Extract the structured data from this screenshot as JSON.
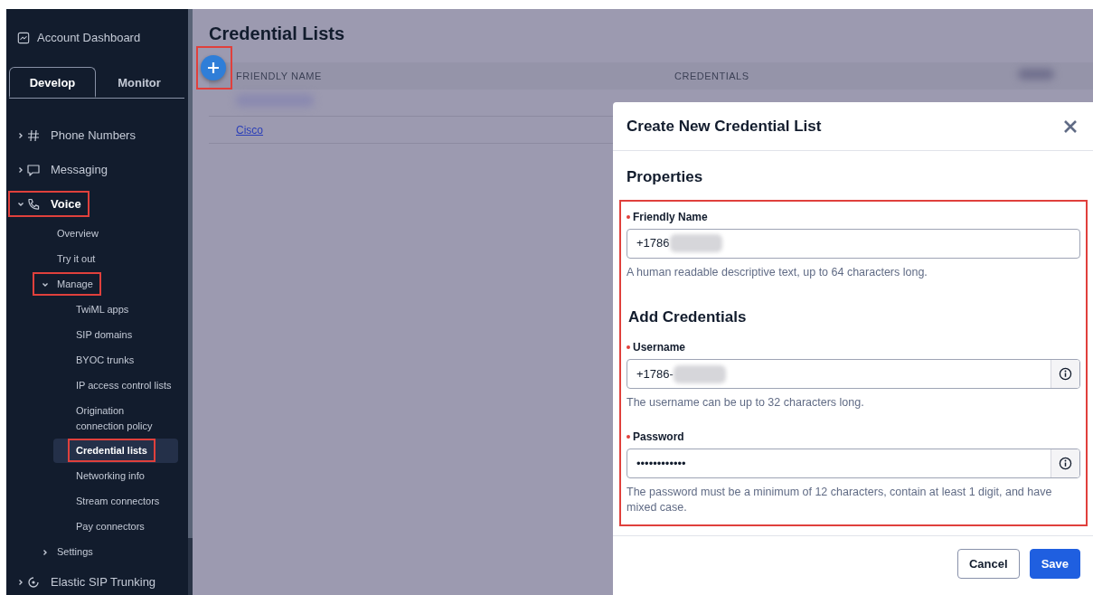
{
  "sidebar": {
    "dashboard_link": "Account Dashboard",
    "tabs": [
      {
        "label": "Develop",
        "selected": true
      },
      {
        "label": "Monitor",
        "selected": false
      }
    ],
    "nav": [
      {
        "label": "Phone Numbers",
        "expanded": false,
        "selected": false,
        "annotated": false
      },
      {
        "label": "Messaging",
        "expanded": false,
        "selected": false,
        "annotated": false
      },
      {
        "label": "Voice",
        "expanded": true,
        "selected": false,
        "annotated": true,
        "children": [
          {
            "label": "Overview",
            "selected": false,
            "annotated": false
          },
          {
            "label": "Try it out",
            "selected": false,
            "annotated": false
          },
          {
            "label": "Manage",
            "expanded": true,
            "selected": false,
            "annotated": true,
            "children": [
              {
                "label": "TwiML apps",
                "selected": false,
                "annotated": false
              },
              {
                "label": "SIP domains",
                "selected": false,
                "annotated": false
              },
              {
                "label": "BYOC trunks",
                "selected": false,
                "annotated": false
              },
              {
                "label": "IP access control lists",
                "selected": false,
                "annotated": false
              },
              {
                "label": "Origination connection policy",
                "selected": false,
                "annotated": false
              },
              {
                "label": "Credential lists",
                "selected": true,
                "annotated": true
              },
              {
                "label": "Networking info",
                "selected": false,
                "annotated": false
              },
              {
                "label": "Stream connectors",
                "selected": false,
                "annotated": false
              },
              {
                "label": "Pay connectors",
                "selected": false,
                "annotated": false
              }
            ]
          },
          {
            "label": "Settings",
            "expanded": false,
            "selected": false,
            "annotated": false
          }
        ]
      },
      {
        "label": "Elastic SIP Trunking",
        "expanded": false,
        "selected": false,
        "annotated": false
      }
    ]
  },
  "page": {
    "title": "Credential Lists",
    "add_button": {
      "annotated": true
    },
    "table": {
      "columns": [
        {
          "label": "FRIENDLY NAME"
        },
        {
          "label": "CREDENTIALS"
        },
        {
          "redacted": true
        }
      ],
      "rows": [
        {
          "redacted": true
        },
        {
          "friendly_name": "Cisco",
          "redacted": false
        }
      ]
    }
  },
  "modal": {
    "title": "Create New Credential List",
    "annotated": true,
    "sections": [
      {
        "heading": "Properties",
        "fields": [
          {
            "label": "Friendly Name",
            "required": true,
            "value": "+1786",
            "redacted": true,
            "info": false,
            "help": "A human readable descriptive text, up to 64 characters long."
          }
        ]
      },
      {
        "heading": "Add Credentials",
        "fields": [
          {
            "label": "Username",
            "required": true,
            "value": "+1786-",
            "redacted": true,
            "info": true,
            "help": "The username can be up to 32 characters long."
          },
          {
            "label": "Password",
            "required": true,
            "value": "••••••••••••",
            "redacted": false,
            "info": true,
            "help": "The password must be a minimum of 12 characters, contain at least 1 digit, and have mixed case."
          }
        ]
      }
    ],
    "buttons": [
      {
        "label": "Cancel",
        "kind": "secondary"
      },
      {
        "label": "Save",
        "kind": "primary"
      }
    ]
  }
}
